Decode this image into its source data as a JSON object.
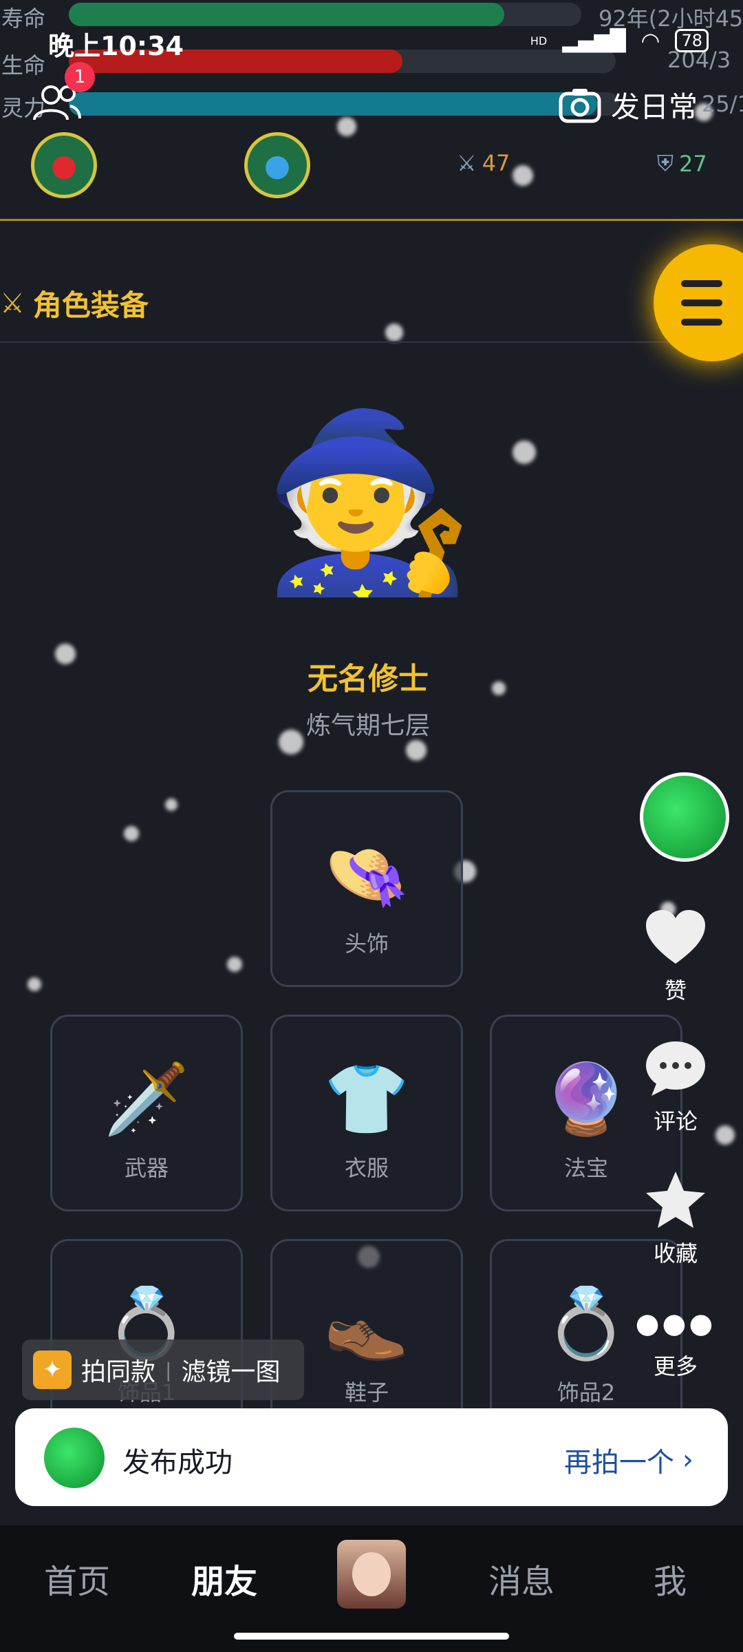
{
  "stats": {
    "lifespan": {
      "label": "寿命",
      "value": "92年(2小时45",
      "fraction": 0.85,
      "color": "#1e7f4e"
    },
    "health": {
      "label": "生命",
      "value": "204/3",
      "fraction": 0.61,
      "color": "#b71c1c"
    },
    "spirit": {
      "label": "灵力",
      "value": "25/1",
      "fraction": 0.96,
      "color": "#137a8f"
    }
  },
  "status_bar": {
    "time": "晚上10:34",
    "battery": "78",
    "network": "HD"
  },
  "top": {
    "friends_badge": "1",
    "post_daily_label": "发日常",
    "attack_value": "47",
    "defense_value": "27"
  },
  "section": {
    "title": "角色装备"
  },
  "character": {
    "name": "无名修士",
    "realm": "炼气期七层",
    "avatar_icon": "🧙"
  },
  "equipment": [
    {
      "id": "headwear",
      "label": "头饰",
      "icon": "👒"
    },
    {
      "id": "weapon",
      "label": "武器",
      "icon": "🗡️"
    },
    {
      "id": "clothes",
      "label": "衣服",
      "icon": "👕"
    },
    {
      "id": "treasure",
      "label": "法宝",
      "icon": "🔮"
    },
    {
      "id": "accessory1",
      "label": "饰品1",
      "icon": "💍"
    },
    {
      "id": "shoes",
      "label": "鞋子",
      "icon": "👞"
    },
    {
      "id": "accessory2",
      "label": "饰品2",
      "icon": "💍"
    }
  ],
  "sidebar": {
    "like_label": "赞",
    "comment_label": "评论",
    "favorite_label": "收藏",
    "more_label": "更多"
  },
  "filter_chip": {
    "shoot_same": "拍同款",
    "filter": "滤镜一图"
  },
  "toast": {
    "message": "发布成功",
    "action": "再拍一个"
  },
  "bottom_nav": {
    "home": "首页",
    "friends": "朋友",
    "messages": "消息",
    "me": "我"
  }
}
